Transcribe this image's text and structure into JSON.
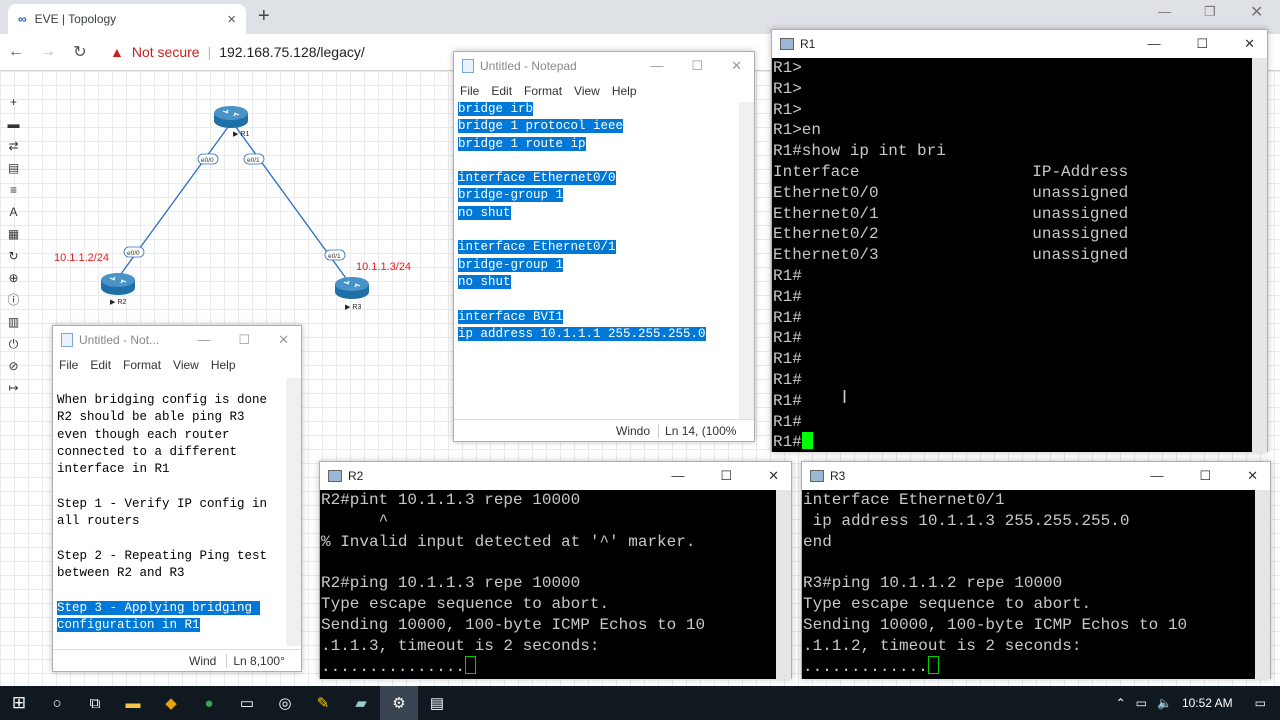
{
  "browser": {
    "tab_title": "EVE | Topology",
    "security_label": "Not secure",
    "url": "192.168.75.128/legacy/"
  },
  "topology": {
    "routers": [
      {
        "name": "R1"
      },
      {
        "name": "R2"
      },
      {
        "name": "R3"
      }
    ],
    "ports": {
      "r1_left": "e0/0",
      "r1_right": "e0/1",
      "r2": "e0/0",
      "r3": "e0/1"
    },
    "ip_r2": "10.1.1.2/24",
    "ip_r3": "10.1.1.3/24",
    "colors": {
      "link": "#2a6ebb",
      "ip_label": "#e02020",
      "router": "#1f6fa8"
    }
  },
  "notepad_small": {
    "title": "Untitled - Not...",
    "menu": [
      "File",
      "Edit",
      "Format",
      "View",
      "Help"
    ],
    "lines": [
      "When bridging config is done",
      "R2 should be able ping R3",
      "even though each router",
      "connected to a different",
      "interface in R1",
      "",
      "Step 1 - Verify IP config in",
      "all routers",
      "",
      "Step 2 - Repeating Ping test",
      "between R2 and R3",
      ""
    ],
    "selected_lines": [
      "Step 3 - Applying bridging ",
      "configuration in R1"
    ],
    "status": {
      "enc": "Wind",
      "pos": "Ln 8, ",
      "zoom": "100°"
    }
  },
  "notepad_big": {
    "title": "Untitled - Notepad",
    "menu": [
      "File",
      "Edit",
      "Format",
      "View",
      "Help"
    ],
    "lines": [
      "bridge irb",
      "bridge 1 protocol ieee",
      "bridge 1 route ip",
      "",
      "interface Ethernet0/0",
      "bridge-group 1",
      "no shut",
      "",
      "interface Ethernet0/1",
      "bridge-group 1",
      "no shut",
      "",
      "interface BVI1",
      "ip address 10.1.1.1 255.255.255.0"
    ],
    "status": {
      "enc": "Windo",
      "pos": "Ln 14, (",
      "zoom": "100%"
    }
  },
  "r1": {
    "title": "R1",
    "lines": [
      "R1>",
      "R1>",
      "R1>",
      "R1>en",
      "R1#show ip int bri",
      "Interface                  IP-Address",
      "Ethernet0/0                unassigned",
      "Ethernet0/1                unassigned",
      "Ethernet0/2                unassigned",
      "Ethernet0/3                unassigned",
      "R1#",
      "R1#",
      "R1#",
      "R1#",
      "R1#",
      "R1#",
      "R1#",
      "R1#"
    ],
    "prompt": "R1#"
  },
  "r2": {
    "title": "R2",
    "lines": [
      "R2#pint 10.1.1.3 repe 10000",
      "      ^",
      "% Invalid input detected at '^' marker.",
      "",
      "R2#ping 10.1.1.3 repe 10000",
      "Type escape sequence to abort.",
      "Sending 10000, 100-byte ICMP Echos to 10",
      ".1.1.3, timeout is 2 seconds:"
    ],
    "prompt": "..............."
  },
  "r3": {
    "title": "R3",
    "lines": [
      "interface Ethernet0/1",
      " ip address 10.1.1.3 255.255.255.0",
      "end",
      "",
      "R3#ping 10.1.1.2 repe 10000",
      "Type escape sequence to abort.",
      "Sending 10000, 100-byte ICMP Echos to 10",
      ".1.1.2, timeout is 2 seconds:"
    ],
    "prompt": "............."
  },
  "taskbar": {
    "time": "10:52 AM"
  }
}
